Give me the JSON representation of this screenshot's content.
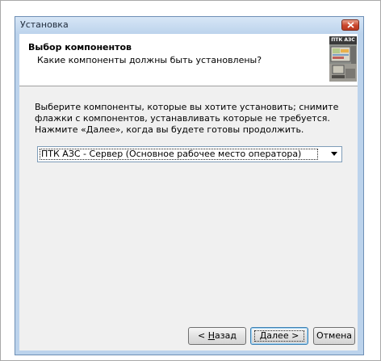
{
  "window": {
    "title": "Установка"
  },
  "header": {
    "title": "Выбор компонентов",
    "subtitle": "Какие компоненты должны быть установлены?",
    "logo_text": "ПТК АЗС"
  },
  "main": {
    "instructions": "Выберите компоненты, которые вы хотите установить; снимите флажки с компонентов, устанавливать которые не требуется. Нажмите «Далее», когда вы будете готовы продолжить.",
    "component_select": {
      "selected": "ПТК АЗС - Сервер (Основное рабочее место оператора)"
    }
  },
  "buttons": {
    "back_prefix": "< ",
    "back_hotkey": "Н",
    "back_rest": "азад",
    "next_hotkey": "Д",
    "next_rest": "алее >",
    "cancel": "Отмена"
  },
  "colors": {
    "title_bar": "#bcd3ec",
    "close_button": "#c9452c",
    "dialog_background": "#f0f0f0"
  }
}
